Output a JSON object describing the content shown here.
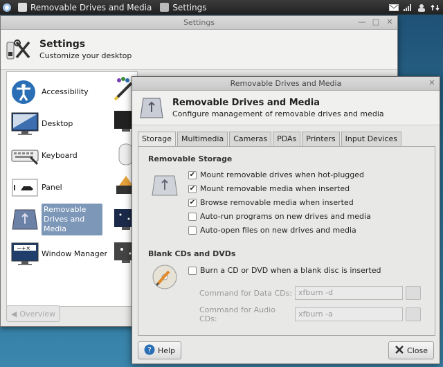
{
  "taskbar": {
    "tasks": [
      {
        "label": "Removable Drives and Media"
      },
      {
        "label": "Settings"
      }
    ]
  },
  "settings_window": {
    "title": "Settings",
    "header_title": "Settings",
    "header_subtitle": "Customize your desktop",
    "categories": [
      {
        "label": "Accessibility"
      },
      {
        "label": "Desktop"
      },
      {
        "label": "Keyboard"
      },
      {
        "label": "Panel"
      },
      {
        "label": "Removable Drives and Media",
        "selected": true
      },
      {
        "label": "Window Manager"
      }
    ],
    "overview_label": "Overview"
  },
  "dialog": {
    "title": "Removable Drives and Media",
    "header_title": "Removable Drives and Media",
    "header_subtitle": "Configure management of removable drives and media",
    "tabs": [
      "Storage",
      "Multimedia",
      "Cameras",
      "PDAs",
      "Printers",
      "Input Devices"
    ],
    "active_tab": "Storage",
    "removable_storage": {
      "title": "Removable Storage",
      "options": [
        {
          "label": "Mount removable drives when hot-plugged",
          "checked": true
        },
        {
          "label": "Mount removable media when inserted",
          "checked": true
        },
        {
          "label": "Browse removable media when inserted",
          "checked": true
        },
        {
          "label": "Auto-run programs on new drives and media",
          "checked": false
        },
        {
          "label": "Auto-open files on new drives and media",
          "checked": false
        }
      ]
    },
    "blank_cds": {
      "title": "Blank CDs and DVDs",
      "burn_label": "Burn a CD or DVD when a blank disc is inserted",
      "burn_checked": false,
      "data_cd_label": "Command for Data CDs:",
      "data_cd_value": "xfburn -d",
      "audio_cd_label": "Command for Audio CDs:",
      "audio_cd_value": "xfburn -a"
    },
    "help_label": "Help",
    "close_label": "Close"
  }
}
